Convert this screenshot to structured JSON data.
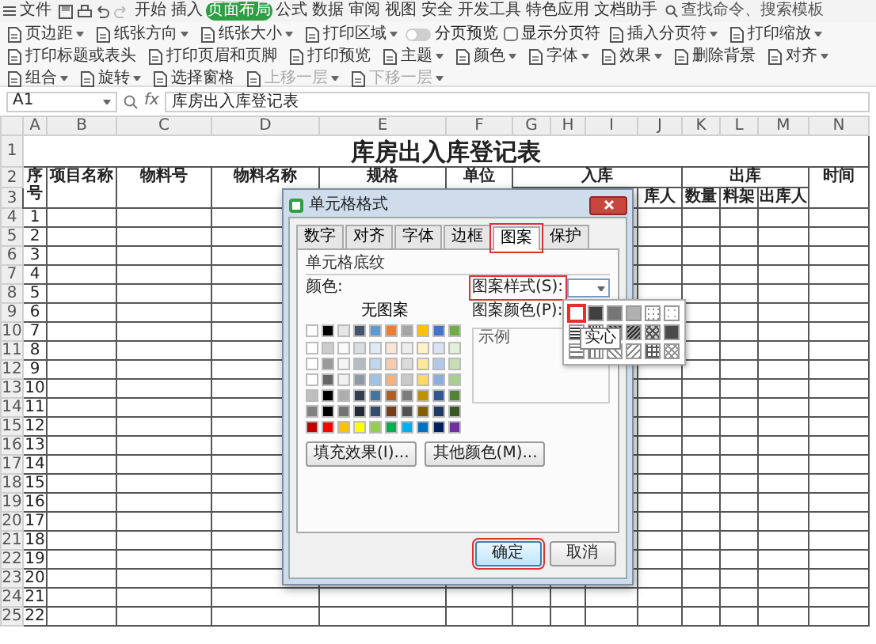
{
  "menu_bar": {
    "app_menu": "文件",
    "tabs": [
      {
        "label": "开始",
        "selected": false
      },
      {
        "label": "插入",
        "selected": false
      },
      {
        "label": "页面布局",
        "selected": true
      },
      {
        "label": "公式",
        "selected": false
      },
      {
        "label": "数据",
        "selected": false
      },
      {
        "label": "审阅",
        "selected": false
      },
      {
        "label": "视图",
        "selected": false
      },
      {
        "label": "安全",
        "selected": false
      },
      {
        "label": "开发工具",
        "selected": false
      },
      {
        "label": "特色应用",
        "selected": false
      },
      {
        "label": "文档助手",
        "selected": false
      }
    ],
    "search": {
      "placeholder": "查找命令、搜索模板"
    }
  },
  "ribbon": [
    {
      "label": "页边距",
      "kind": "button",
      "dropdown": true,
      "disabled": false
    },
    {
      "label": "纸张方向",
      "kind": "button",
      "dropdown": true,
      "disabled": false
    },
    {
      "label": "纸张大小",
      "kind": "button",
      "dropdown": true,
      "disabled": false
    },
    {
      "label": "打印区域",
      "kind": "button",
      "dropdown": true,
      "disabled": false
    },
    {
      "label": "分页预览",
      "kind": "toggle",
      "on": false
    },
    {
      "label": "显示分页符",
      "kind": "checkbox",
      "checked": false
    },
    {
      "label": "插入分页符",
      "kind": "button",
      "dropdown": true,
      "disabled": false
    },
    {
      "label": "打印缩放",
      "kind": "button",
      "dropdown": true,
      "disabled": false
    },
    {
      "label": "打印标题或表头",
      "kind": "button",
      "dropdown": false,
      "disabled": false
    },
    {
      "label": "打印页眉和页脚",
      "kind": "button",
      "dropdown": false,
      "disabled": false
    },
    {
      "label": "打印预览",
      "kind": "button",
      "dropdown": false,
      "disabled": false
    },
    {
      "label": "主题",
      "kind": "button",
      "dropdown": true,
      "disabled": false
    },
    {
      "label": "颜色",
      "kind": "button",
      "dropdown": true,
      "disabled": false
    },
    {
      "label": "字体",
      "kind": "button",
      "dropdown": true,
      "disabled": false
    },
    {
      "label": "效果",
      "kind": "button",
      "dropdown": true,
      "disabled": false
    },
    {
      "label": "删除背景",
      "kind": "button",
      "dropdown": false,
      "disabled": false
    },
    {
      "label": "对齐",
      "kind": "button",
      "dropdown": true,
      "disabled": false
    },
    {
      "label": "组合",
      "kind": "button",
      "dropdown": true,
      "disabled": false
    },
    {
      "label": "旋转",
      "kind": "button",
      "dropdown": true,
      "disabled": false
    },
    {
      "label": "选择窗格",
      "kind": "button",
      "dropdown": false,
      "disabled": false
    },
    {
      "label": "上移一层",
      "kind": "button",
      "dropdown": true,
      "disabled": true
    },
    {
      "label": "下移一层",
      "kind": "button",
      "dropdown": true,
      "disabled": true
    }
  ],
  "formula_bar": {
    "cell_ref": "A1",
    "function_label": "fx",
    "formula": "库房出入库登记表"
  },
  "sheet": {
    "columns": [
      "A",
      "B",
      "C",
      "D",
      "E",
      "F",
      "G",
      "H",
      "I",
      "J",
      "K",
      "L",
      "M",
      "N"
    ],
    "title": "库房出入库登记表",
    "header_row_1": [
      {
        "text": "序号"
      },
      {
        "text": "项目名称"
      },
      {
        "text": "物料号"
      },
      {
        "text": "物料名称"
      },
      {
        "text": "规格"
      },
      {
        "text": "单位"
      },
      {
        "text": "入库"
      },
      {
        "text": "出库"
      },
      {
        "text": "时间"
      }
    ],
    "header_row_2": [
      {
        "text": "库人"
      },
      {
        "text": "数量"
      },
      {
        "text": "料架"
      },
      {
        "text": "出库人"
      }
    ],
    "row_labels": [
      "1",
      "2",
      "3",
      "4",
      "5",
      "6",
      "7",
      "8",
      "9",
      "10",
      "11",
      "12",
      "13",
      "14",
      "15",
      "16",
      "17",
      "18",
      "19",
      "20",
      "21",
      "22",
      "23",
      "24",
      "25"
    ],
    "sequence": [
      "1",
      "2",
      "3",
      "4",
      "5",
      "6",
      "7",
      "8",
      "9",
      "10",
      "11",
      "12",
      "13",
      "14",
      "15",
      "16",
      "17",
      "18",
      "19",
      "20",
      "21",
      "22"
    ]
  },
  "dialog": {
    "title": "单元格格式",
    "tabs": [
      {
        "label": "数字",
        "selected": false,
        "highlighted": false
      },
      {
        "label": "对齐",
        "selected": false,
        "highlighted": false
      },
      {
        "label": "字体",
        "selected": false,
        "highlighted": false
      },
      {
        "label": "边框",
        "selected": false,
        "highlighted": false
      },
      {
        "label": "图案",
        "selected": true,
        "highlighted": true
      },
      {
        "label": "保护",
        "selected": false,
        "highlighted": false
      }
    ],
    "group_title": "单元格底纹",
    "color_label": "颜色:",
    "no_pattern": "无图案",
    "theme_colors": [
      {
        "color": "#ffffff"
      },
      {
        "color": "#000000"
      },
      {
        "color": "#e7e6e6"
      },
      {
        "color": "#44546a"
      },
      {
        "color": "#5b9bd5"
      },
      {
        "color": "#ed7d31"
      },
      {
        "color": "#a5a5a5"
      },
      {
        "color": "#ffc000"
      },
      {
        "color": "#4472c4"
      },
      {
        "color": "#70ad47"
      }
    ],
    "standard_colors": [
      {
        "color": "#c00000"
      },
      {
        "color": "#ff0000"
      },
      {
        "color": "#ffc000"
      },
      {
        "color": "#ffff00"
      },
      {
        "color": "#92d050"
      },
      {
        "color": "#00b050"
      },
      {
        "color": "#00b0f0"
      },
      {
        "color": "#0070c0"
      },
      {
        "color": "#002060"
      },
      {
        "color": "#7030a0"
      }
    ],
    "fill_effects_button": "填充效果(I)...",
    "more_colors_button": "其他颜色(M)...",
    "pattern_style": {
      "label": "图案样式(S):",
      "highlighted": true
    },
    "pattern_color": {
      "label": "图案颜色(P):"
    },
    "pattern_menu": {
      "tooltip": "实心",
      "patterns": [
        {
          "kind": "solid",
          "selected": true
        },
        {
          "kind": "gray75",
          "selected": false
        },
        {
          "kind": "gray50",
          "selected": false
        },
        {
          "kind": "gray25",
          "selected": false
        },
        {
          "kind": "gray12",
          "selected": false
        },
        {
          "kind": "gray6",
          "selected": false
        },
        {
          "kind": "hstripe",
          "selected": false
        },
        {
          "kind": "vstripe",
          "selected": false
        },
        {
          "kind": "rdiag",
          "selected": false
        },
        {
          "kind": "ldiag",
          "selected": false
        },
        {
          "kind": "cross",
          "selected": false
        },
        {
          "kind": "thickcross",
          "selected": false
        },
        {
          "kind": "thinh",
          "selected": false
        },
        {
          "kind": "thinv",
          "selected": false
        },
        {
          "kind": "thinrdiag",
          "selected": false
        },
        {
          "kind": "thinldiag",
          "selected": false
        },
        {
          "kind": "thingrid",
          "selected": false
        },
        {
          "kind": "thincross",
          "selected": false
        }
      ]
    },
    "sample_label": "示例",
    "buttons": [
      {
        "label": "确定",
        "default": true,
        "highlighted": true
      },
      {
        "label": "取消",
        "default": false,
        "highlighted": false
      }
    ]
  }
}
